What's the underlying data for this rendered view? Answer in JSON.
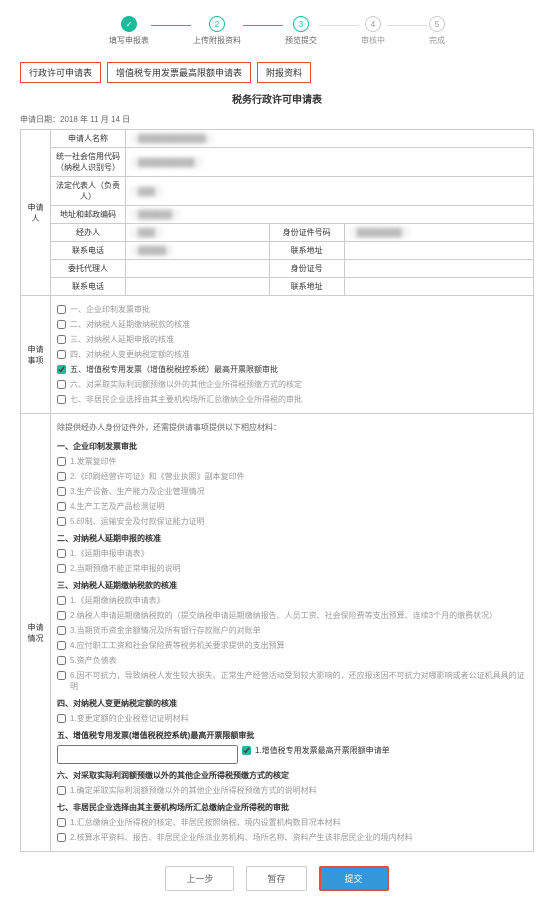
{
  "stepper": {
    "steps": [
      {
        "num": "✓",
        "label": "填写申报表"
      },
      {
        "num": "2",
        "label": "上传附报资料"
      },
      {
        "num": "3",
        "label": "预览提交"
      },
      {
        "num": "4",
        "label": "审核中"
      },
      {
        "num": "5",
        "label": "完成"
      }
    ]
  },
  "tabs": {
    "t1": "行政许可申请表",
    "t2": "增值税专用发票最高限额申请表",
    "t3": "附报资料"
  },
  "form_title": "税务行政许可申请表",
  "apply_date_label": "申请日期：",
  "apply_date_value": "2018 年 11 月 14 日",
  "applicant": {
    "section": "申请人",
    "fields": {
      "name_label": "申请人名称",
      "credit_label": "统一社会信用代码（纳税人识别号）",
      "legal_label": "法定代表人（负责人）",
      "addr_label": "地址和邮政编码",
      "handler_label": "经办人",
      "id_label": "身份证件号码",
      "contact_label": "联系电话",
      "net_label": "联系地址",
      "agent_label": "委托代理人",
      "agent_id_label": "身份证号",
      "agent_phone_label": "联系电话",
      "agent_addr_label": "联系地址"
    }
  },
  "matters": {
    "section": "申请事项",
    "items": [
      "一、企业印制发票审批",
      "二、对纳税人延期缴纳税款的核准",
      "三、对纳税人延期申报的核准",
      "四、对纳税人变更纳税定额的核准",
      "五、增值税专用发票（增值税税控系统）最高开票限额审批",
      "六、对采取实际利润额预缴以外的其他企业所得税预缴方式的核定",
      "七、非居民企业选择由其主要机构场所汇总缴纳企业所得税的审批"
    ],
    "checked_index": 4
  },
  "situation": {
    "section": "申请情况",
    "intro": "除提供经办人身份证件外，还需提供请事项提供以下相应材料：",
    "g1_title": "一、企业印制发票审批",
    "g1_items": [
      "1.发票复印件",
      "2.《印刷经营许可证》和《营业执照》副本复印件",
      "3.生产设备、生产能力及企业管理情况",
      "4.生产工艺及产品检测证明",
      "5.印制、运输安全及付款保证能力证明"
    ],
    "g2_title": "二、对纳税人延期申报的核准",
    "g2_items": [
      "1.《延期申报申请表》",
      "2.当期预缴不能正常申报的说明"
    ],
    "g3_title": "三、对纳税人延期缴纳税款的核准",
    "g3_items": [
      "1.《延期缴纳税款申请表》",
      "2.纳税人申请延期缴纳税款的（提交纳税申请延期缴纳报告、人员工资、社会保险费等支出预算、连续3个月的缴费状况）",
      "3.当期货币资金余额情况及所有银行存款账户的对账单",
      "4.应付职工工资和社会保险费等税务机关要求提供的支出预算",
      "5.资产负债表",
      "6.因不可抗力，导致纳税人发生较大损失、正常生产经营活动受到较大影响的，还应报送因不可抗力对哪影响或者公证机具具的证明"
    ],
    "g4_title": "四、对纳税人变更纳税定额的核准",
    "g4_items": [
      "1.变更定额的企业税登记证明材料"
    ],
    "g5_title": "五、增值税专用发票(增值税税控系统)最高开票限额审批",
    "g5_items": [
      "1.增值税专用发票最高开票限额申请单"
    ],
    "g5_checked": 0,
    "g6_title": "六、对采取实际利润额预缴以外的其他企业所得税预缴方式的核定",
    "g6_items": [
      "1.确定采取实际利润额预缴以外的其他企业所得税预缴方式的说明材料"
    ],
    "g7_title": "七、非居民企业选择由其主要机构场所汇总缴纳企业所得税的审批",
    "g7_items": [
      "1.汇总缴纳企业所得税的核定、非居民按照纳税、境内设置机构数目况本材料",
      "2.核算水平资料、报告、非居民企业所派业务机构、场所名称、资料产生该非居民企业的境内材料"
    ]
  },
  "buttons": {
    "prev": "上一步",
    "save": "暂存",
    "submit": "提交"
  }
}
